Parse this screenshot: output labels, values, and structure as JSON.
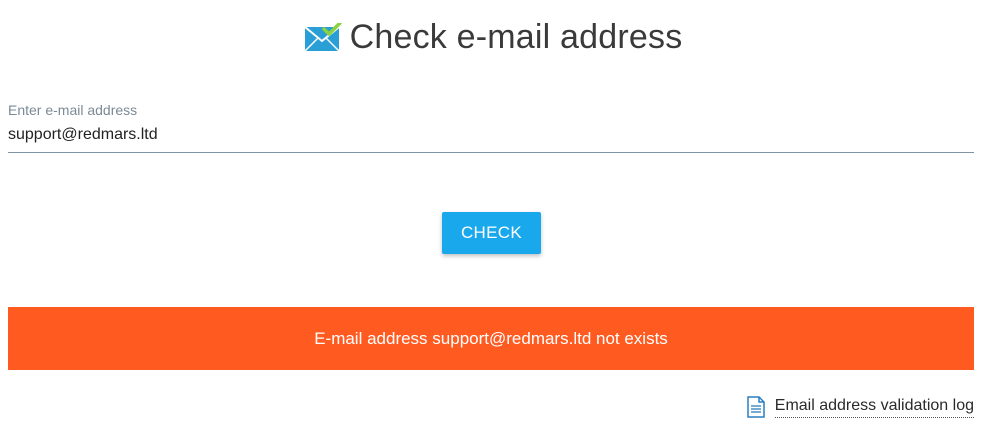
{
  "header": {
    "title": "Check e-mail address",
    "icon": "envelope-check-icon",
    "icon_color": "#2a9fd6"
  },
  "form": {
    "email_label": "Enter e-mail address",
    "email_value": "support@redmars.ltd",
    "check_label": "CHECK"
  },
  "result": {
    "message": "E-mail address support@redmars.ltd not exists",
    "status": "error",
    "color": "#ff5a1f"
  },
  "footer": {
    "log_link_label": "Email address validation log",
    "log_icon": "document-icon"
  },
  "colors": {
    "accent": "#1aa8ec",
    "error": "#ff5a1f"
  }
}
